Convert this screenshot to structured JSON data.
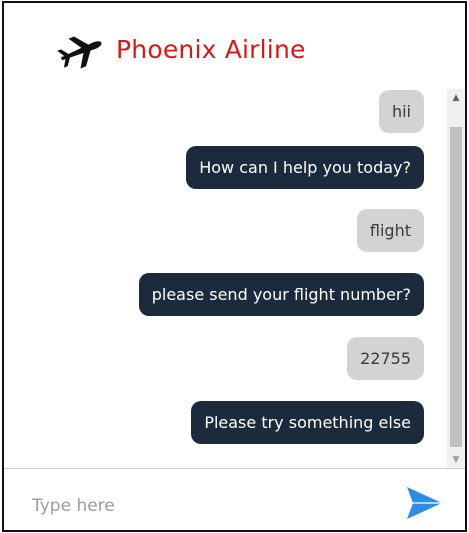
{
  "header": {
    "title": "Phoenix Airline",
    "logo_icon": "airplane-icon",
    "title_color": "#d21a1a"
  },
  "messages": [
    {
      "sender": "user",
      "text": "hii"
    },
    {
      "sender": "bot",
      "text": "How can I help you today?"
    },
    {
      "sender": "user",
      "text": "flight"
    },
    {
      "sender": "bot",
      "text": "please send your flight number?"
    },
    {
      "sender": "user",
      "text": "22755"
    },
    {
      "sender": "bot",
      "text": "Please try something else"
    }
  ],
  "input": {
    "placeholder": "Type here",
    "value": "",
    "send_icon": "send-icon"
  },
  "colors": {
    "bot_bubble": "#1b2a3d",
    "user_bubble": "#d3d3d3",
    "send_accent": "#2f8be6"
  }
}
